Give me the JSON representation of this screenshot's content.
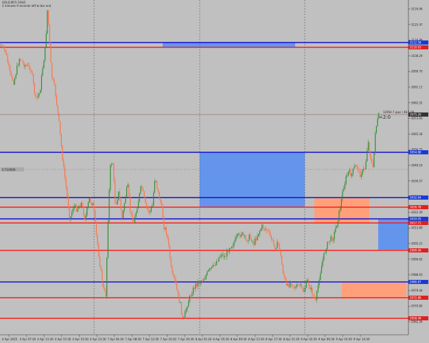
{
  "header": {
    "symbol_line": "GOLD,M15  GOLD",
    "countdown_line": "2 minutes 9 seconds left to bar end"
  },
  "left_label": "0.71AR06",
  "timer_badge": "<2:0",
  "spread_info": "12954.7 pips | 48.1 00",
  "colors": {
    "background": "#c0c0c0",
    "bull_candle": "#2e8b2e",
    "bear_candle": "#ff7043",
    "support_line": "#ff1a1a",
    "resistance_line": "#1010d0",
    "demand_zone": "#6495ed",
    "supply_zone": "#ffa07a",
    "current_price_tag": "#333333",
    "price_tag_blue": "#1a3ad6",
    "price_tag_red": "#e02020"
  },
  "y_axis_labels": [
    "3134.06",
    "3125.47",
    "3116.88",
    "3108.29",
    "3099.70",
    "3091.11",
    "3082.52",
    "3073.93",
    "3065.34",
    "3056.75",
    "3048.16",
    "3039.57",
    "3030.98",
    "3022.39",
    "3013.80",
    "3005.21",
    "2996.62",
    "2988.03",
    "2979.44",
    "2970.85",
    "2962.26"
  ],
  "level_tags": [
    {
      "text": "3112.58",
      "color": "blue"
    },
    {
      "text": "3110.93",
      "color": "red"
    },
    {
      "text": "3075.26",
      "color": "gray"
    },
    {
      "text": "3054.88",
      "color": "blue"
    },
    {
      "text": "3032.64",
      "color": "blue"
    },
    {
      "text": "3026.78",
      "color": "red"
    },
    {
      "text": "3019.05",
      "color": "blue"
    },
    {
      "text": "3017.71",
      "color": "red"
    },
    {
      "text": "2999.46",
      "color": "red"
    },
    {
      "text": "2980.87",
      "color": "blue"
    },
    {
      "text": "2972.88",
      "color": "red"
    },
    {
      "text": "2958.49",
      "color": "red"
    }
  ],
  "x_axis_labels": [
    "4 Apr 2025",
    "4 Apr 07:30",
    "4 Apr 11:30",
    "4 Apr 15:30",
    "4 Apr 19:30",
    "4 Apr 23:30",
    "7 Apr 04:30",
    "7 Apr 08:30",
    "7 Apr 12:30",
    "7 Apr 16:30",
    "7 Apr 20:30",
    "8 Apr 01:30",
    "8 Apr 05:30",
    "8 Apr 09:30",
    "8 Apr 13:30",
    "8 Apr 17:30",
    "8 Apr 21:30",
    "9 Apr 02:30",
    "9 Apr 06:30",
    "9 Apr 10:30",
    "9 Apr 14:30"
  ]
}
